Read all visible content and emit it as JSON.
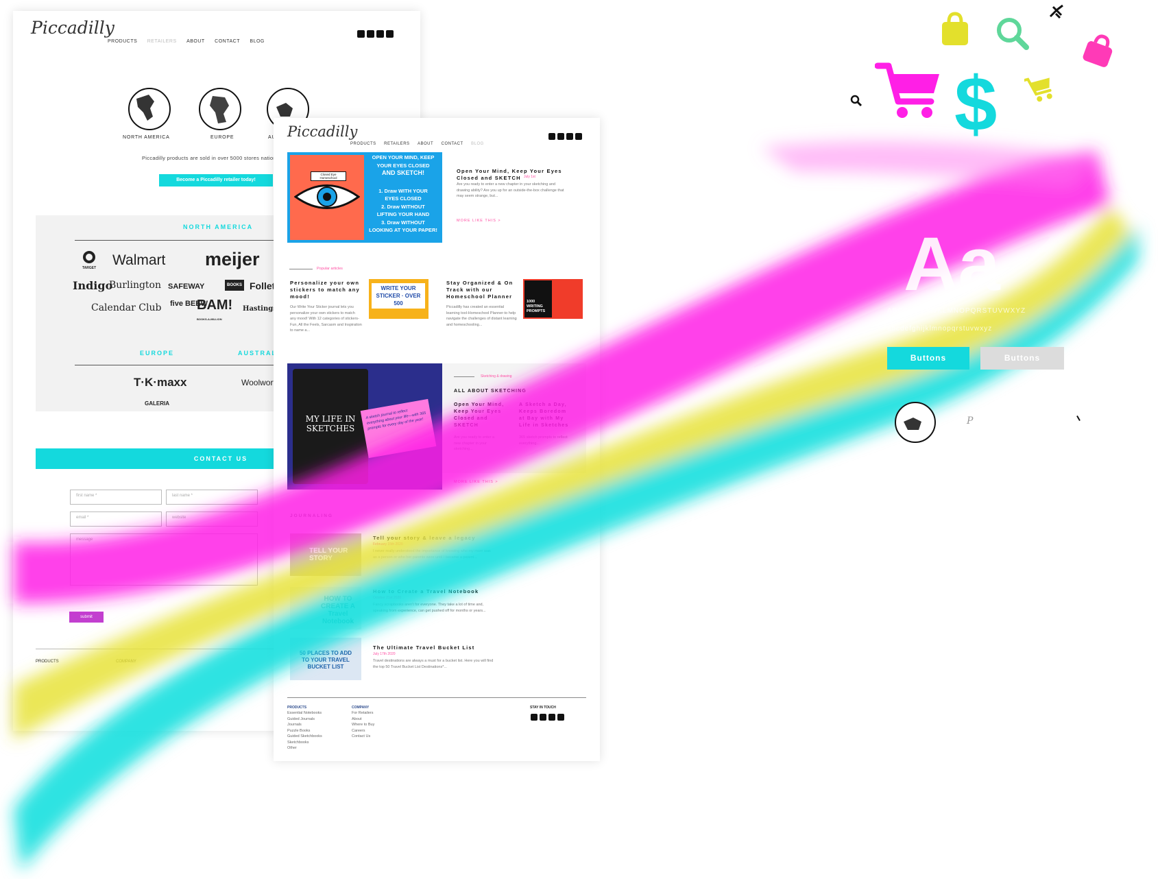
{
  "colors": {
    "teal": "#14d9dd",
    "magenta": "#ff1fe6",
    "yellow": "#e6e23a",
    "pink": "#ff2fa0",
    "grey_button": "#dcdcdc"
  },
  "page1": {
    "logo": "Piccadilly",
    "nav": [
      "PRODUCTS",
      "RETAILERS",
      "ABOUT",
      "CONTACT",
      "BLOG"
    ],
    "regions": [
      "NORTH AMERICA",
      "EUROPE",
      "AUSTRALIA"
    ],
    "sold_text": "Piccadilly products are sold in over 5000 stores nationwide",
    "cta": "Become a Piccadilly retailer today!",
    "na_heading": "NORTH AMERICA",
    "na_brands": [
      "TARGET",
      "Walmart",
      "meijer",
      "Indigo",
      "Burlington",
      "SAFEWAY",
      "BOOKS",
      "Follett",
      "Calendar Club",
      "five BEEW",
      "BAM!",
      "BOOKS-A-MILLION",
      "Hastings"
    ],
    "eu_heading": "EUROPE",
    "au_heading": "AUSTRALIA",
    "eu_brands": [
      "T·K·maxx",
      "GALERIA"
    ],
    "au_brands": [
      "Woolworths"
    ],
    "contact_heading": "CONTACT US",
    "form": {
      "first": "first name *",
      "last": "last name *",
      "email": "email *",
      "website": "website",
      "message": "message",
      "submit": "submit"
    },
    "footer": {
      "products": "PRODUCTS",
      "company": "COMPANY"
    }
  },
  "page2": {
    "logo": "Piccadilly",
    "nav": [
      "PRODUCTS",
      "RETAILERS",
      "ABOUT",
      "CONTACT",
      "BLOG"
    ],
    "hero_image": {
      "lines": [
        "OPEN YOUR MIND, KEEP",
        "YOUR EYES CLOSED",
        "AND SKETCH!",
        "1. Draw WITH YOUR",
        "EYES CLOSED",
        "2. Draw WITHOUT",
        "LIFTING YOUR HAND",
        "3. Draw WITHOUT",
        "LOOKING AT YOUR PAPER!"
      ],
      "badge": "Closed Eye Homeschool"
    },
    "hero": {
      "title": "Open Your Mind, Keep Your Eyes Closed and SKETCH",
      "date": "July 1st",
      "excerpt": "Are you ready to enter a new chapter in your sketching and drawing ability? Are you up for an outside-the-box challenge that may seem strange, but...",
      "more": "MORE LIKE THIS >"
    },
    "popular_label": "Popular articles",
    "popular": [
      {
        "title": "Personalize your own stickers to match any mood!",
        "excerpt": "Our Write Your Sticker journal lets you personalize your own stickers to match any mood! With 12 categories of stickers-Fun, All the Feels, Sarcasm and Inspiration to name a...",
        "img": "WRITE YOUR STICKER · OVER 500"
      },
      {
        "title": "Stay Organized & On Track with our Homeschool Planner",
        "excerpt": "Piccadilly has created an essential learning tool-Homeschool Planner-to help navigate the challenges of distant learning and homeschooling...",
        "img": "1000 WRITING PROMPTS"
      }
    ],
    "sketch_kicker": "Sketching & drawing",
    "sketch_heading": "ALL ABOUT SKETCHING",
    "sketch_book": "MY LIFE IN SKETCHES",
    "sketch_card": "A sketch journal to reflect everything about your life—with 365 prompts for every day of the year!",
    "sketch_items": [
      {
        "title": "Open Your Mind, Keep Your Eyes Closed and SKETCH",
        "excerpt": "Are you ready to enter a new chapter in your sketching..."
      },
      {
        "title": "A Sketch a Day, Keeps Boredom at Bay with My Life in Sketches",
        "excerpt": "365 sketch prompts to reflect everything..."
      }
    ],
    "sketch_more": "MORE LIKE THIS >",
    "journaling_heading": "JOURNALING",
    "journal": [
      {
        "title": "Tell your story & leave a legacy",
        "date": "February 15th 2020",
        "excerpt": "I never really understood the importance of knowing who my mom was as a person or who her parents were until I became a parent...",
        "img": "TELL YOUR STORY"
      },
      {
        "title": "How to Create a Travel Notebook",
        "date": "October 21st 2020",
        "excerpt": "Fancy scrapbooks aren't for everyone. They take a lot of time and, speaking from experience, can get pushed off for months or years...",
        "img": "HOW TO CREATE A Travel Notebook"
      },
      {
        "title": "The Ultimate Travel Bucket List",
        "date": "July 17th 2020",
        "excerpt": "Travel destinations are always a must for a bucket list. Here you will find the top 50 Travel Bucket List Destinations*...",
        "img": "50 PLACES TO ADD TO YOUR TRAVEL BUCKET LIST"
      }
    ],
    "footer": {
      "products_heading": "PRODUCTS",
      "products": [
        "Essential Notebooks",
        "Guided Journals",
        "Journals",
        "Puzzle Books",
        "Guided Sketchbooks",
        "Sketchbooks",
        "Other"
      ],
      "company_heading": "COMPANY",
      "company": [
        "For Retailers",
        "About",
        "Where to Buy",
        "Careers",
        "Contact Us"
      ],
      "stay_heading": "STAY IN TOUCH"
    }
  },
  "style_guide": {
    "type_sample": "Aa",
    "uppercase": "ABCDEFGHIJKLMNOPQRSTUVWXYZ",
    "lowercase": "abcdefghijklmnopqrstuvwxyz",
    "button_primary": "Buttons",
    "button_secondary": "Buttons",
    "icons": [
      "shopping-bag-icon",
      "search-icon",
      "magnet-icon",
      "shopping-cart-icon",
      "dollar-icon",
      "shopping-bag-icon",
      "shopping-cart-icon",
      "search-icon",
      "globe-icon"
    ]
  }
}
